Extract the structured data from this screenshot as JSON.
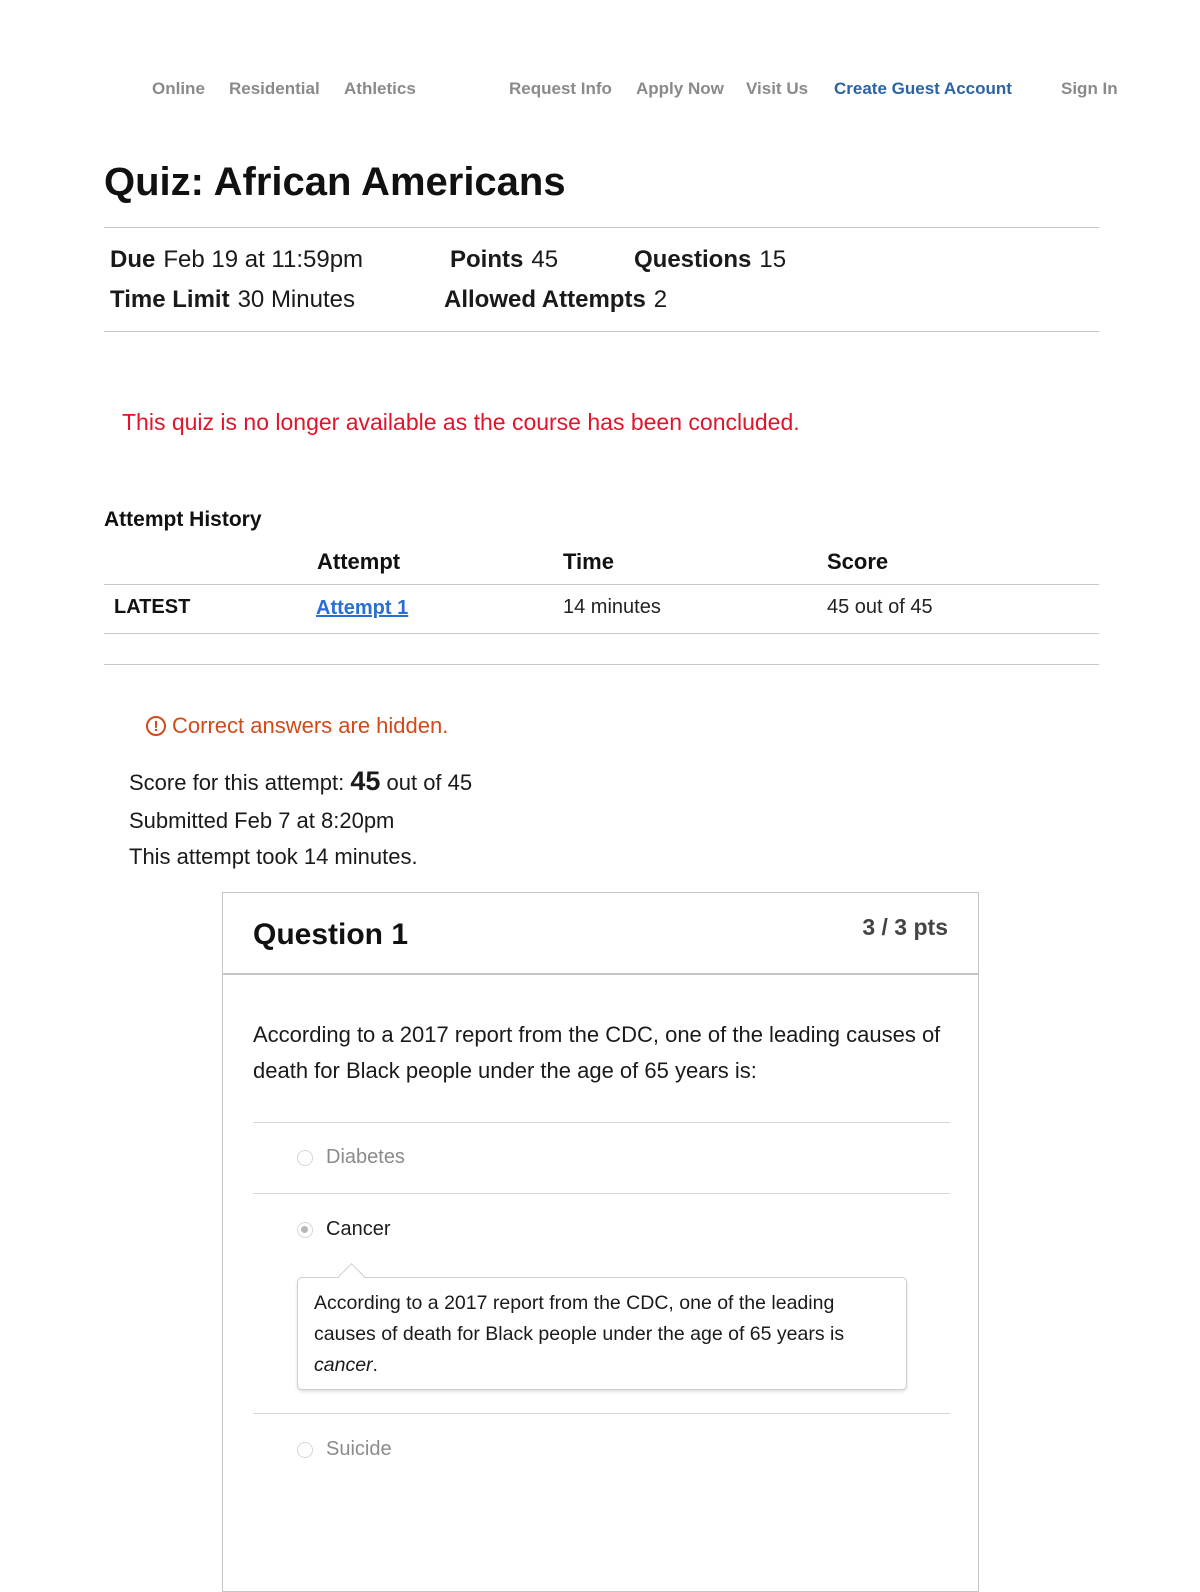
{
  "nav": {
    "online": "Online",
    "residential": "Residential",
    "athletics": "Athletics",
    "request_info": "Request Info",
    "apply_now": "Apply Now",
    "visit_us": "Visit Us",
    "create_guest_account": "Create Guest Account",
    "sign_in": "Sign In"
  },
  "quiz": {
    "title": "Quiz: African Americans",
    "due_label": "Due",
    "due_value": "Feb 19 at 11:59pm",
    "points_label": "Points",
    "points_value": "45",
    "questions_label": "Questions",
    "questions_value": "15",
    "time_limit_label": "Time Limit",
    "time_limit_value": "30 Minutes",
    "allowed_attempts_label": "Allowed Attempts",
    "allowed_attempts_value": "2",
    "concluded_notice": "This quiz is no longer available as the course has been concluded."
  },
  "attempt_history": {
    "title": "Attempt History",
    "columns": [
      "Attempt",
      "Time",
      "Score"
    ],
    "rows": [
      {
        "tag": "LATEST",
        "attempt": "Attempt 1",
        "time": "14 minutes",
        "score": "45 out of 45"
      }
    ]
  },
  "attempt_summary": {
    "notice": "Correct answers are hidden.",
    "notice_icon": "!",
    "score_prefix": "Score for this attempt:",
    "score_value": "45",
    "score_suffix": "out of 45",
    "submitted": "Submitted Feb 7 at 8:20pm",
    "duration": "This attempt took 14 minutes."
  },
  "question": {
    "title": "Question 1",
    "points": "3 / 3 pts",
    "text": "According to a 2017 report from the CDC, one of the leading causes of death for Black people under the age of 65 years is:",
    "options": [
      {
        "label": "Diabetes",
        "selected": false
      },
      {
        "label": "Cancer",
        "selected": true
      },
      {
        "label": "Suicide",
        "selected": false
      }
    ],
    "feedback_text": "According to a 2017 report from the CDC, one of the leading causes of death for Black people under the age of 65 years is",
    "feedback_emphasis": "cancer",
    "feedback_end": "."
  },
  "colors": {
    "link_blue": "#2b63a6",
    "error_red": "#e0152b",
    "warning_orange": "#d2491a"
  }
}
